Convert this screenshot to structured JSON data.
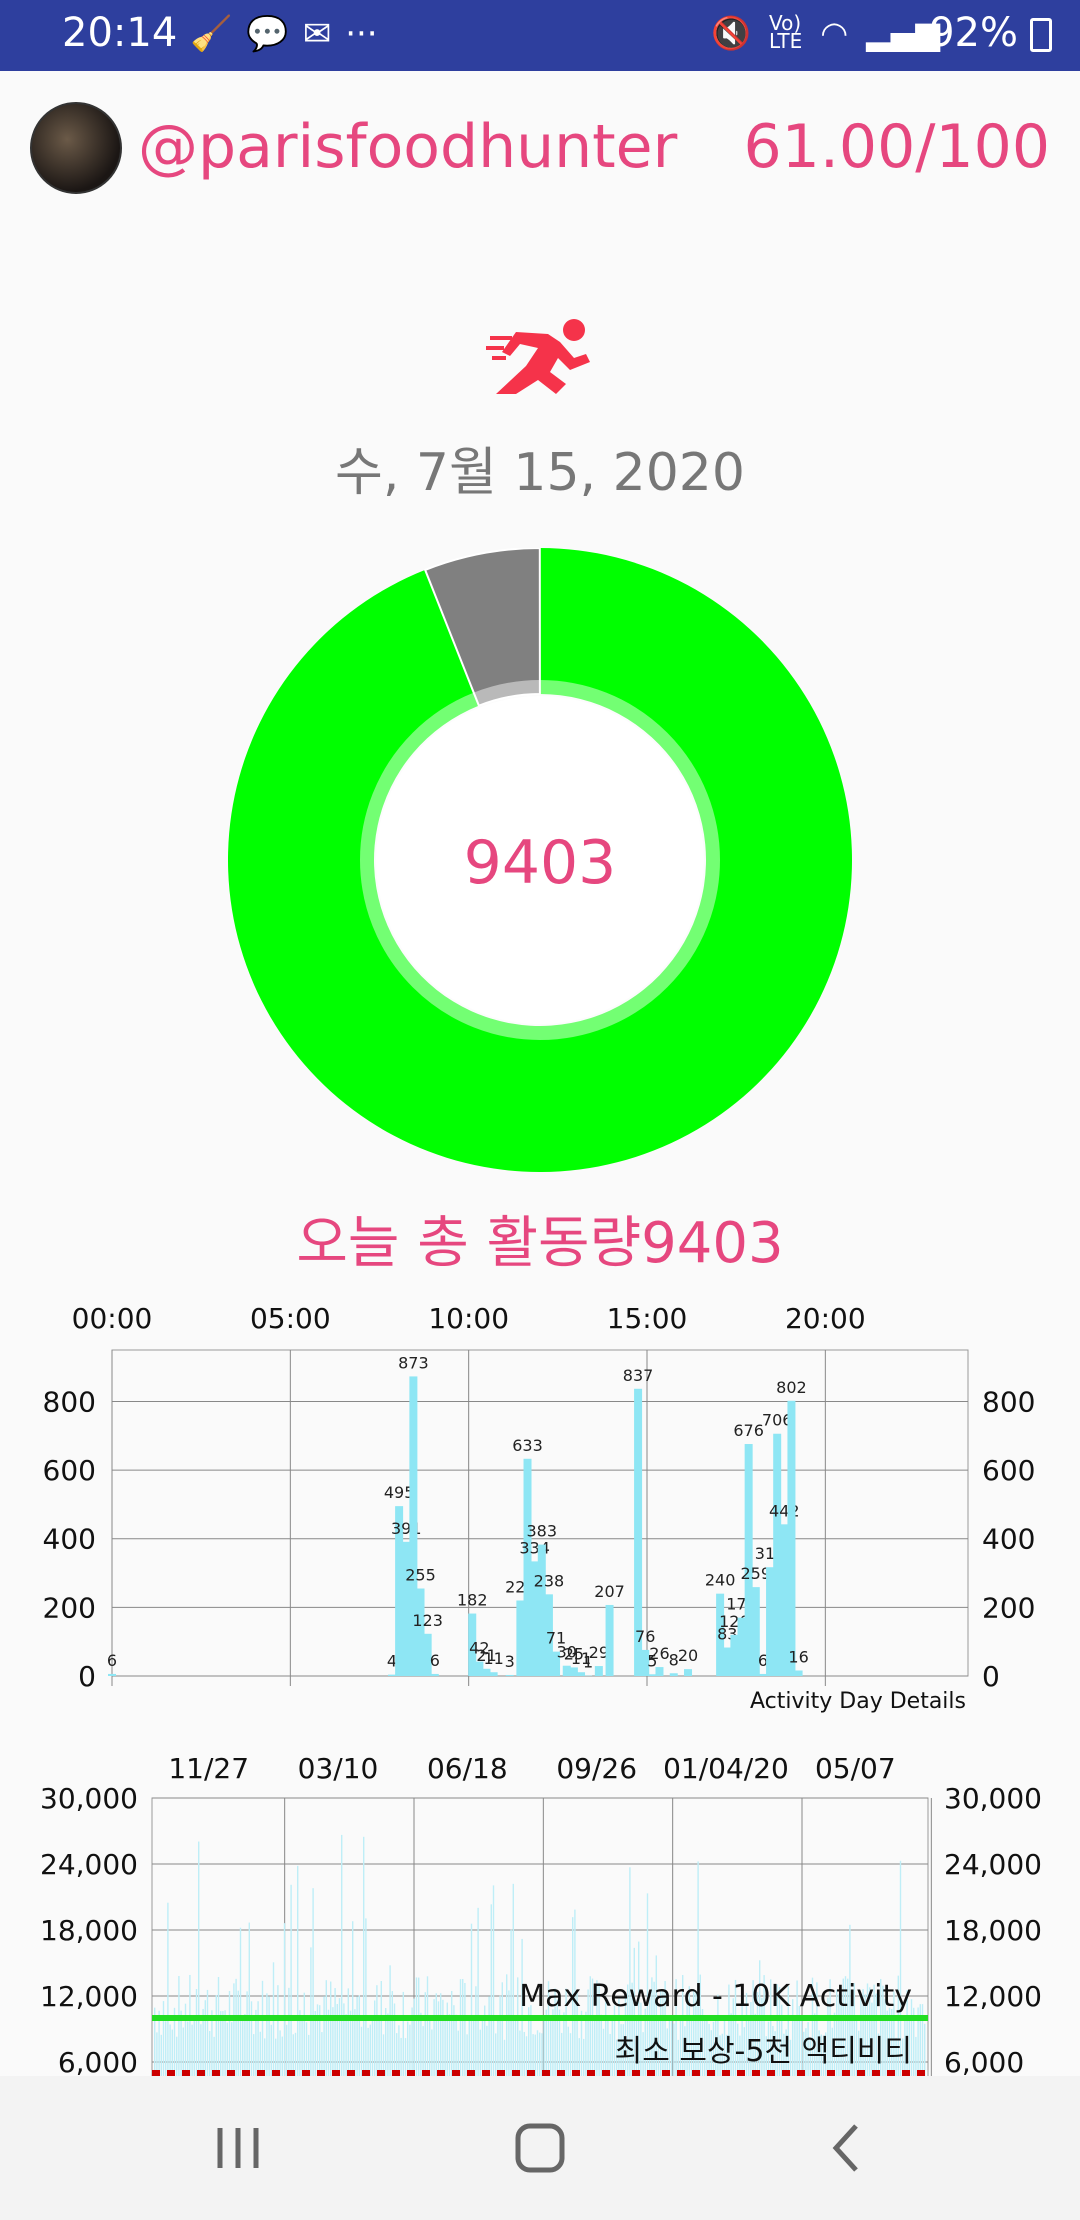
{
  "status_bar": {
    "time": "20:14",
    "left_icons": [
      "broom-icon",
      "chat-bubble-icon",
      "mail-icon",
      "more-dots-icon"
    ],
    "right_icons": [
      "mute-icon",
      "volte-icon",
      "wifi-icon",
      "signal-icon"
    ],
    "battery": "92%"
  },
  "profile": {
    "username": "@parisfoodhunter",
    "score": "61.00/100"
  },
  "date": "수, 7월 15, 2020",
  "activity": {
    "value": "9403",
    "progress_fraction": 0.94,
    "total_label": "오늘 총 활동량9403",
    "colors": {
      "done": "#00ff00",
      "remaining": "#808080",
      "accent": "#e6477f"
    }
  },
  "chart_data": [
    {
      "type": "bar",
      "title": "",
      "annotation": "Activity Day Details",
      "x_ticks": [
        "00:00",
        "05:00",
        "10:00",
        "15:00",
        "20:00"
      ],
      "x_tick_hours": [
        0,
        5,
        10,
        15,
        20
      ],
      "y_ticks": [
        "0",
        "200",
        "400",
        "600",
        "800"
      ],
      "ylim": [
        0,
        950
      ],
      "xlim": [
        0,
        24
      ],
      "grid": true,
      "bar_color": "#8ee6f4",
      "x": [
        0,
        7.85,
        8.05,
        8.25,
        8.45,
        8.65,
        8.85,
        9.05,
        10.1,
        10.3,
        10.5,
        10.7,
        11.15,
        11.45,
        11.65,
        11.85,
        12.05,
        12.25,
        12.45,
        12.75,
        12.95,
        13.15,
        13.35,
        13.65,
        13.95,
        14.75,
        14.95,
        15.15,
        15.35,
        15.75,
        16.15,
        17.05,
        17.25,
        17.45,
        17.65,
        17.85,
        18.05,
        18.25,
        18.45,
        18.65,
        18.85,
        19.05,
        19.25,
        19.45,
        19.65
      ],
      "values": [
        6,
        4,
        495,
        391,
        873,
        255,
        123,
        6,
        182,
        42,
        21,
        11,
        3,
        220,
        633,
        334,
        383,
        238,
        71,
        30,
        25,
        11,
        1,
        29,
        207,
        837,
        76,
        5,
        26,
        8,
        20,
        240,
        83,
        120,
        170,
        676,
        259,
        6,
        317,
        706,
        442,
        802,
        16,
        0,
        0
      ],
      "value_labels": [
        "6",
        "4",
        "495",
        "391",
        "873",
        "255",
        "123",
        "6",
        "182",
        "42",
        "21",
        "11",
        "3",
        "220",
        "633",
        "334",
        "383",
        "238",
        "71",
        "30",
        "25",
        "11",
        "1",
        "29",
        "207",
        "837",
        "76",
        "5",
        "26",
        "8",
        "20",
        "240",
        "83",
        "120",
        "170",
        "676",
        "259",
        "6",
        "317",
        "706",
        "442",
        "802",
        "16",
        "",
        ""
      ]
    },
    {
      "type": "bar",
      "title": "",
      "x_ticks": [
        "11/27",
        "03/10",
        "06/18",
        "09/26",
        "01/04/20",
        "05/07"
      ],
      "y_ticks": [
        "6,000",
        "12,000",
        "18,000",
        "24,000",
        "30,000"
      ],
      "y_tick_values": [
        6000,
        12000,
        18000,
        24000,
        30000
      ],
      "ylim": [
        4500,
        30000
      ],
      "grid": true,
      "bar_color": "#bfeef7",
      "reference_lines": [
        {
          "label": "Max Reward - 10K Activity",
          "value": 10000,
          "color": "#22dd22",
          "style": "solid"
        },
        {
          "label": "최소 보상-5천 액티비티",
          "value": 5000,
          "color": "#cc0000",
          "style": "dashed"
        }
      ],
      "daily_activity_summary": "dense daily bars, mostly 8,000-14,000 with peaks up to ~27,000"
    }
  ]
}
